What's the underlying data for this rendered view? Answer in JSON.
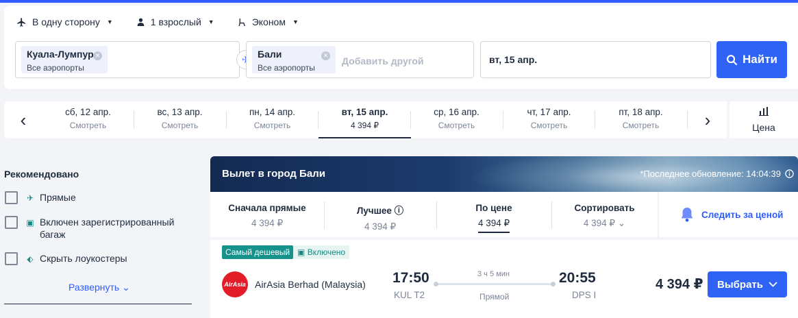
{
  "search": {
    "trip_type": "В одну сторону",
    "passengers": "1 взрослый",
    "cabin": "Эконом",
    "origin": {
      "city": "Куала-Лумпур",
      "airports": "Все аэропорты"
    },
    "destination": {
      "city": "Бали",
      "airports": "Все аэропорты"
    },
    "add_other": "Добавить другой",
    "date": "вт, 15 апр.",
    "find_label": "Найти"
  },
  "dates": [
    {
      "date": "сб, 12 апр.",
      "price": "Смотреть"
    },
    {
      "date": "вс, 13 апр.",
      "price": "Смотреть"
    },
    {
      "date": "пн, 14 апр.",
      "price": "Смотреть"
    },
    {
      "date": "вт, 15 апр.",
      "price": "4 394 ₽",
      "active": true
    },
    {
      "date": "ср, 16 апр.",
      "price": "Смотреть"
    },
    {
      "date": "чт, 17 апр.",
      "price": "Смотреть"
    },
    {
      "date": "пт, 18 апр.",
      "price": "Смотреть"
    }
  ],
  "price_tab": "Цена",
  "filters": {
    "title": "Рекомендовано",
    "items": [
      "Прямые",
      "Включен зарегистрированный багаж",
      "Скрыть лоукостеры"
    ],
    "expand": "Развернуть"
  },
  "results": {
    "banner_title": "Вылет в город Бали",
    "last_update": "*Последнее обновление: 14:04:39",
    "sort": [
      {
        "label": "Сначала прямые",
        "value": "4 394 ₽"
      },
      {
        "label": "Лучшее",
        "value": "4 394 ₽"
      },
      {
        "label": "По цене",
        "value": "4 394 ₽",
        "active": true
      },
      {
        "label": "Сортировать",
        "value": "4 394 ₽"
      }
    ],
    "follow_price": "Следить за ценой",
    "ticket": {
      "tag_cheapest": "Самый дешевый",
      "tag_included": "Включено",
      "logo_text": "AirAsia",
      "airline": "AirAsia Berhad (Malaysia)",
      "dep_time": "17:50",
      "dep_airport": "KUL T2",
      "duration": "3 ч 5 мин",
      "stops": "Прямой",
      "arr_time": "20:55",
      "arr_airport": "DPS I",
      "price": "4 394 ₽",
      "select_label": "Выбрать"
    }
  },
  "colors": {
    "accent": "#2f63f5",
    "teal": "#14928b",
    "text": "#1f2b3d",
    "muted": "#7b8595"
  }
}
